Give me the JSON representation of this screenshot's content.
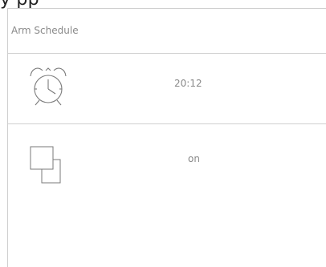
{
  "page_header": {
    "fragment": "y    pp"
  },
  "card": {
    "title": "Arm Schedule"
  },
  "schedule_time": {
    "icon": "alarm-clock-icon",
    "value": "20:12"
  },
  "schedule_status": {
    "icon": "overlapping-squares-icon",
    "value": "on"
  },
  "colors": {
    "text_muted": "#8a8a8a",
    "divider": "#cfcfcf",
    "icon_stroke": "#7a7a7a"
  }
}
